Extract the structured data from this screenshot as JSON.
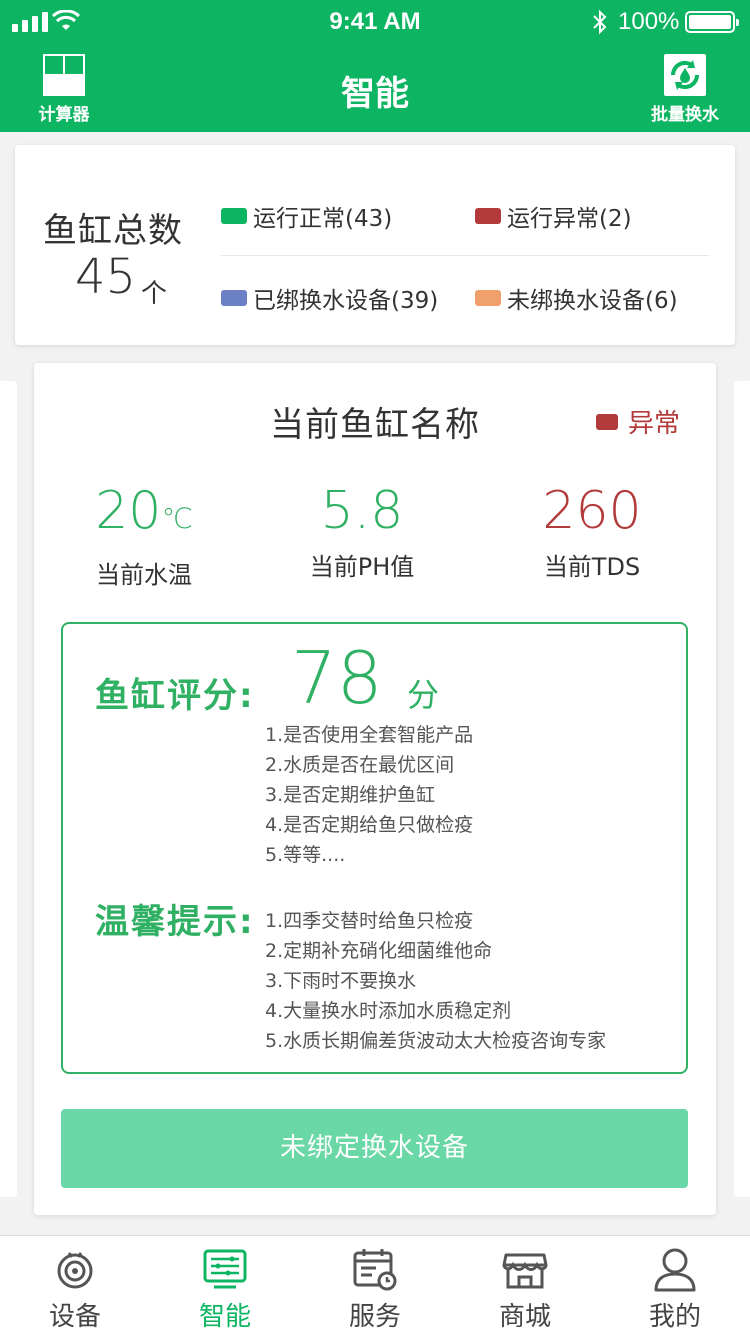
{
  "status_bar": {
    "time": "9:41 AM",
    "battery": "100%"
  },
  "header": {
    "title": "智能",
    "left_button": {
      "label": "计算器",
      "icon": "calculator-icon"
    },
    "right_button": {
      "label": "批量换水",
      "icon": "water-exchange-icon"
    }
  },
  "summary": {
    "total_label": "鱼缸总数",
    "total_count": "45",
    "total_unit": "个",
    "legend": [
      {
        "label": "运行正常(43)",
        "color": "#0db562"
      },
      {
        "label": "运行异常(2)",
        "color": "#b33a3a"
      },
      {
        "label": "已绑换水设备(39)",
        "color": "#6a7fc4"
      },
      {
        "label": "未绑换水设备(6)",
        "color": "#f0a06a"
      }
    ]
  },
  "tank": {
    "name": "当前鱼缸名称",
    "status": "异常",
    "status_color": "#b33a3a",
    "metrics": {
      "temp": {
        "value": "20",
        "unit": "℃",
        "label": "当前水温",
        "color": "#2fb063"
      },
      "ph": {
        "value": "5.8",
        "label": "当前PH值",
        "color": "#2fb063"
      },
      "tds": {
        "value": "260",
        "label": "当前TDS",
        "color": "#b33a3a"
      }
    },
    "score": {
      "label": "鱼缸评分:",
      "value": "78",
      "unit": "分",
      "criteria": [
        "1.是否使用全套智能产品",
        "2.水质是否在最优区间",
        "3.是否定期维护鱼缸",
        "4.是否定期给鱼只做检疫",
        "5.等等...."
      ]
    },
    "tips": {
      "label": "温馨提示:",
      "items": [
        "1.四季交替时给鱼只检疫",
        "2.定期补充硝化细菌维他命",
        "3.下雨时不要换水",
        "4.大量换水时添加水质稳定剂",
        "5.水质长期偏差货波动太大检疫咨询专家"
      ]
    },
    "bind_button": "未绑定换水设备"
  },
  "tabs": {
    "device": "设备",
    "smart": "智能",
    "service": "服务",
    "shop": "商城",
    "mine": "我的"
  }
}
